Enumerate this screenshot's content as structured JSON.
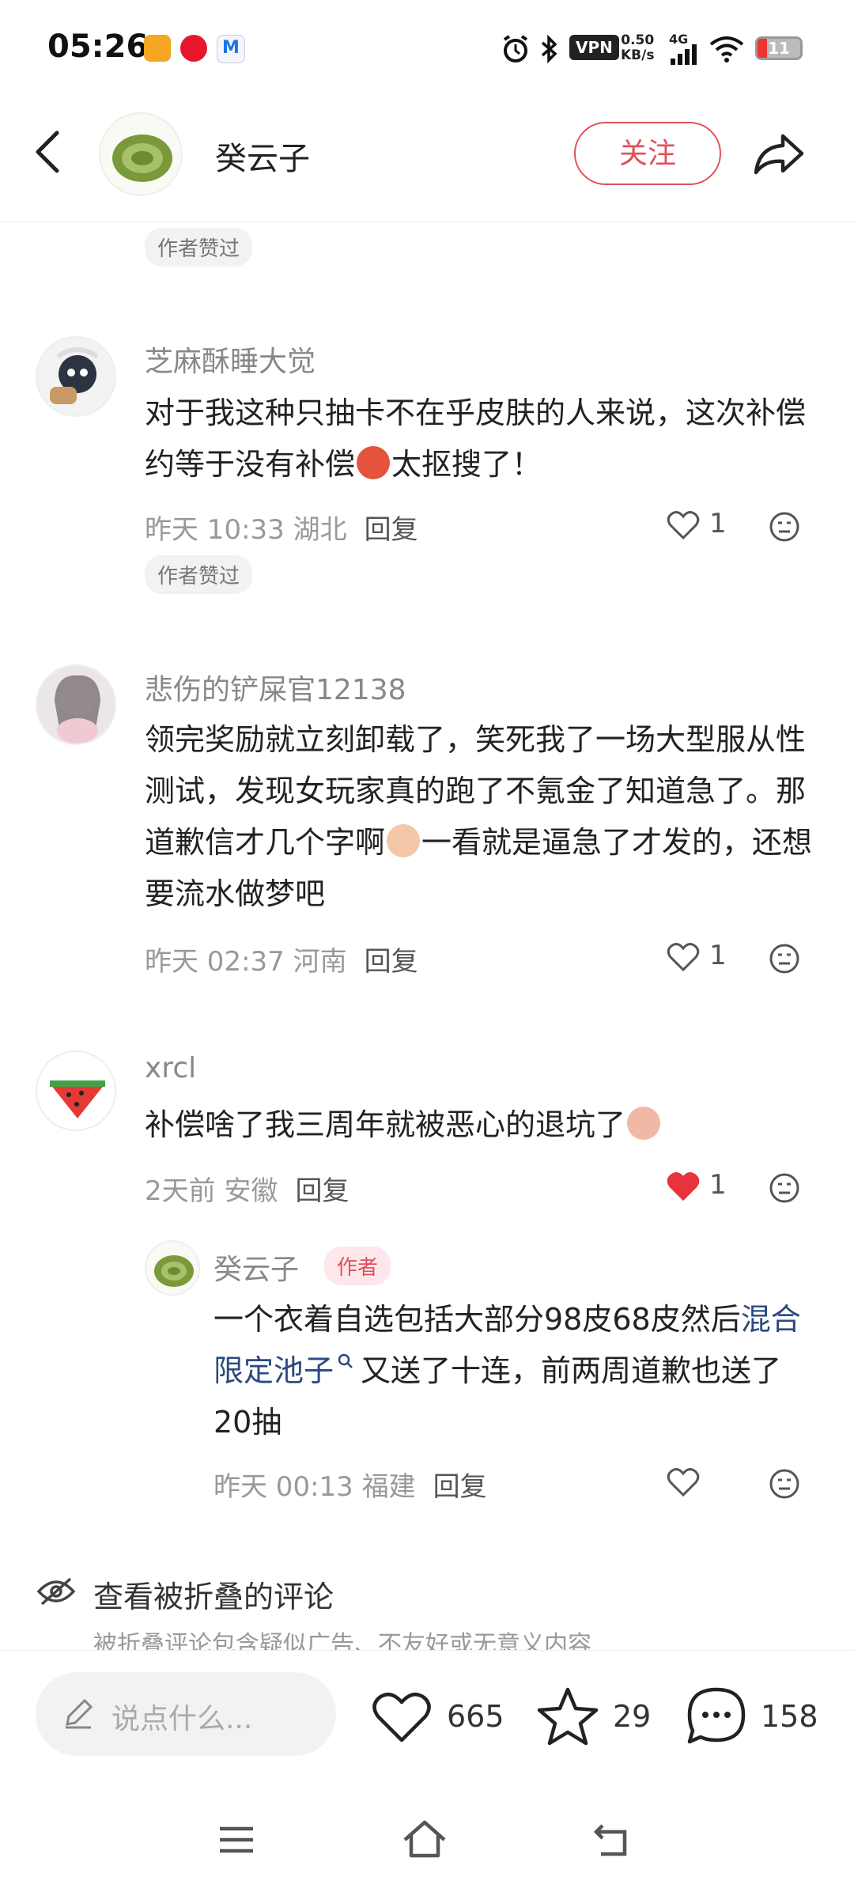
{
  "status_bar": {
    "time": "05:26",
    "vpn": "VPN",
    "net_speed": "0.50",
    "net_unit": "KB/s",
    "signal": "4G",
    "battery": "11"
  },
  "header": {
    "author_name": "癸云子",
    "follow_label": "关注"
  },
  "prev_comment": {
    "liked_badge": "作者赞过"
  },
  "comments": [
    {
      "user": "芝麻酥睡大觉",
      "text_a": "对于我这种只抽卡不在乎皮肤的人来说，这次补偿约等于没有补偿",
      "text_b": "太抠搜了！",
      "time": "昨天 10:33",
      "location": "湖北",
      "reply_label": "回复",
      "likes": "1",
      "liked_badge": "作者赞过"
    },
    {
      "user": "悲伤的铲屎官12138",
      "text_a": "领完奖励就立刻卸载了，笑死我了一场大型服从性测试，发现女玩家真的跑了不氪金了知道急了。那道歉信才几个字啊",
      "text_b": "一看就是逼急了才发的，还想要流水做梦吧",
      "time": "昨天 02:37",
      "location": "河南",
      "reply_label": "回复",
      "likes": "1"
    },
    {
      "user": "xrcl",
      "text_a": "补偿啥了我三周年就被恶心的退坑了",
      "time": "2天前",
      "location": "安徽",
      "reply_label": "回复",
      "likes": "1"
    }
  ],
  "author_reply": {
    "user": "癸云子",
    "badge": "作者",
    "text_a": "一个衣着自选包括大部分98皮68皮然后",
    "link": "混合限定池子",
    "text_b": "又送了十连，前两周道歉也送了20抽",
    "time": "昨天 00:13",
    "location": "福建",
    "reply_label": "回复"
  },
  "folded": {
    "title": "查看被折叠的评论",
    "subtitle": "被折叠评论包含疑似广告、不友好或无意义内容"
  },
  "bottom_bar": {
    "input_placeholder": "说点什么...",
    "likes": "665",
    "favorites": "29",
    "comments": "158"
  },
  "colors": {
    "accent": "#e0505a",
    "liked_heart": "#e8323c",
    "link": "#2b4a7e"
  }
}
